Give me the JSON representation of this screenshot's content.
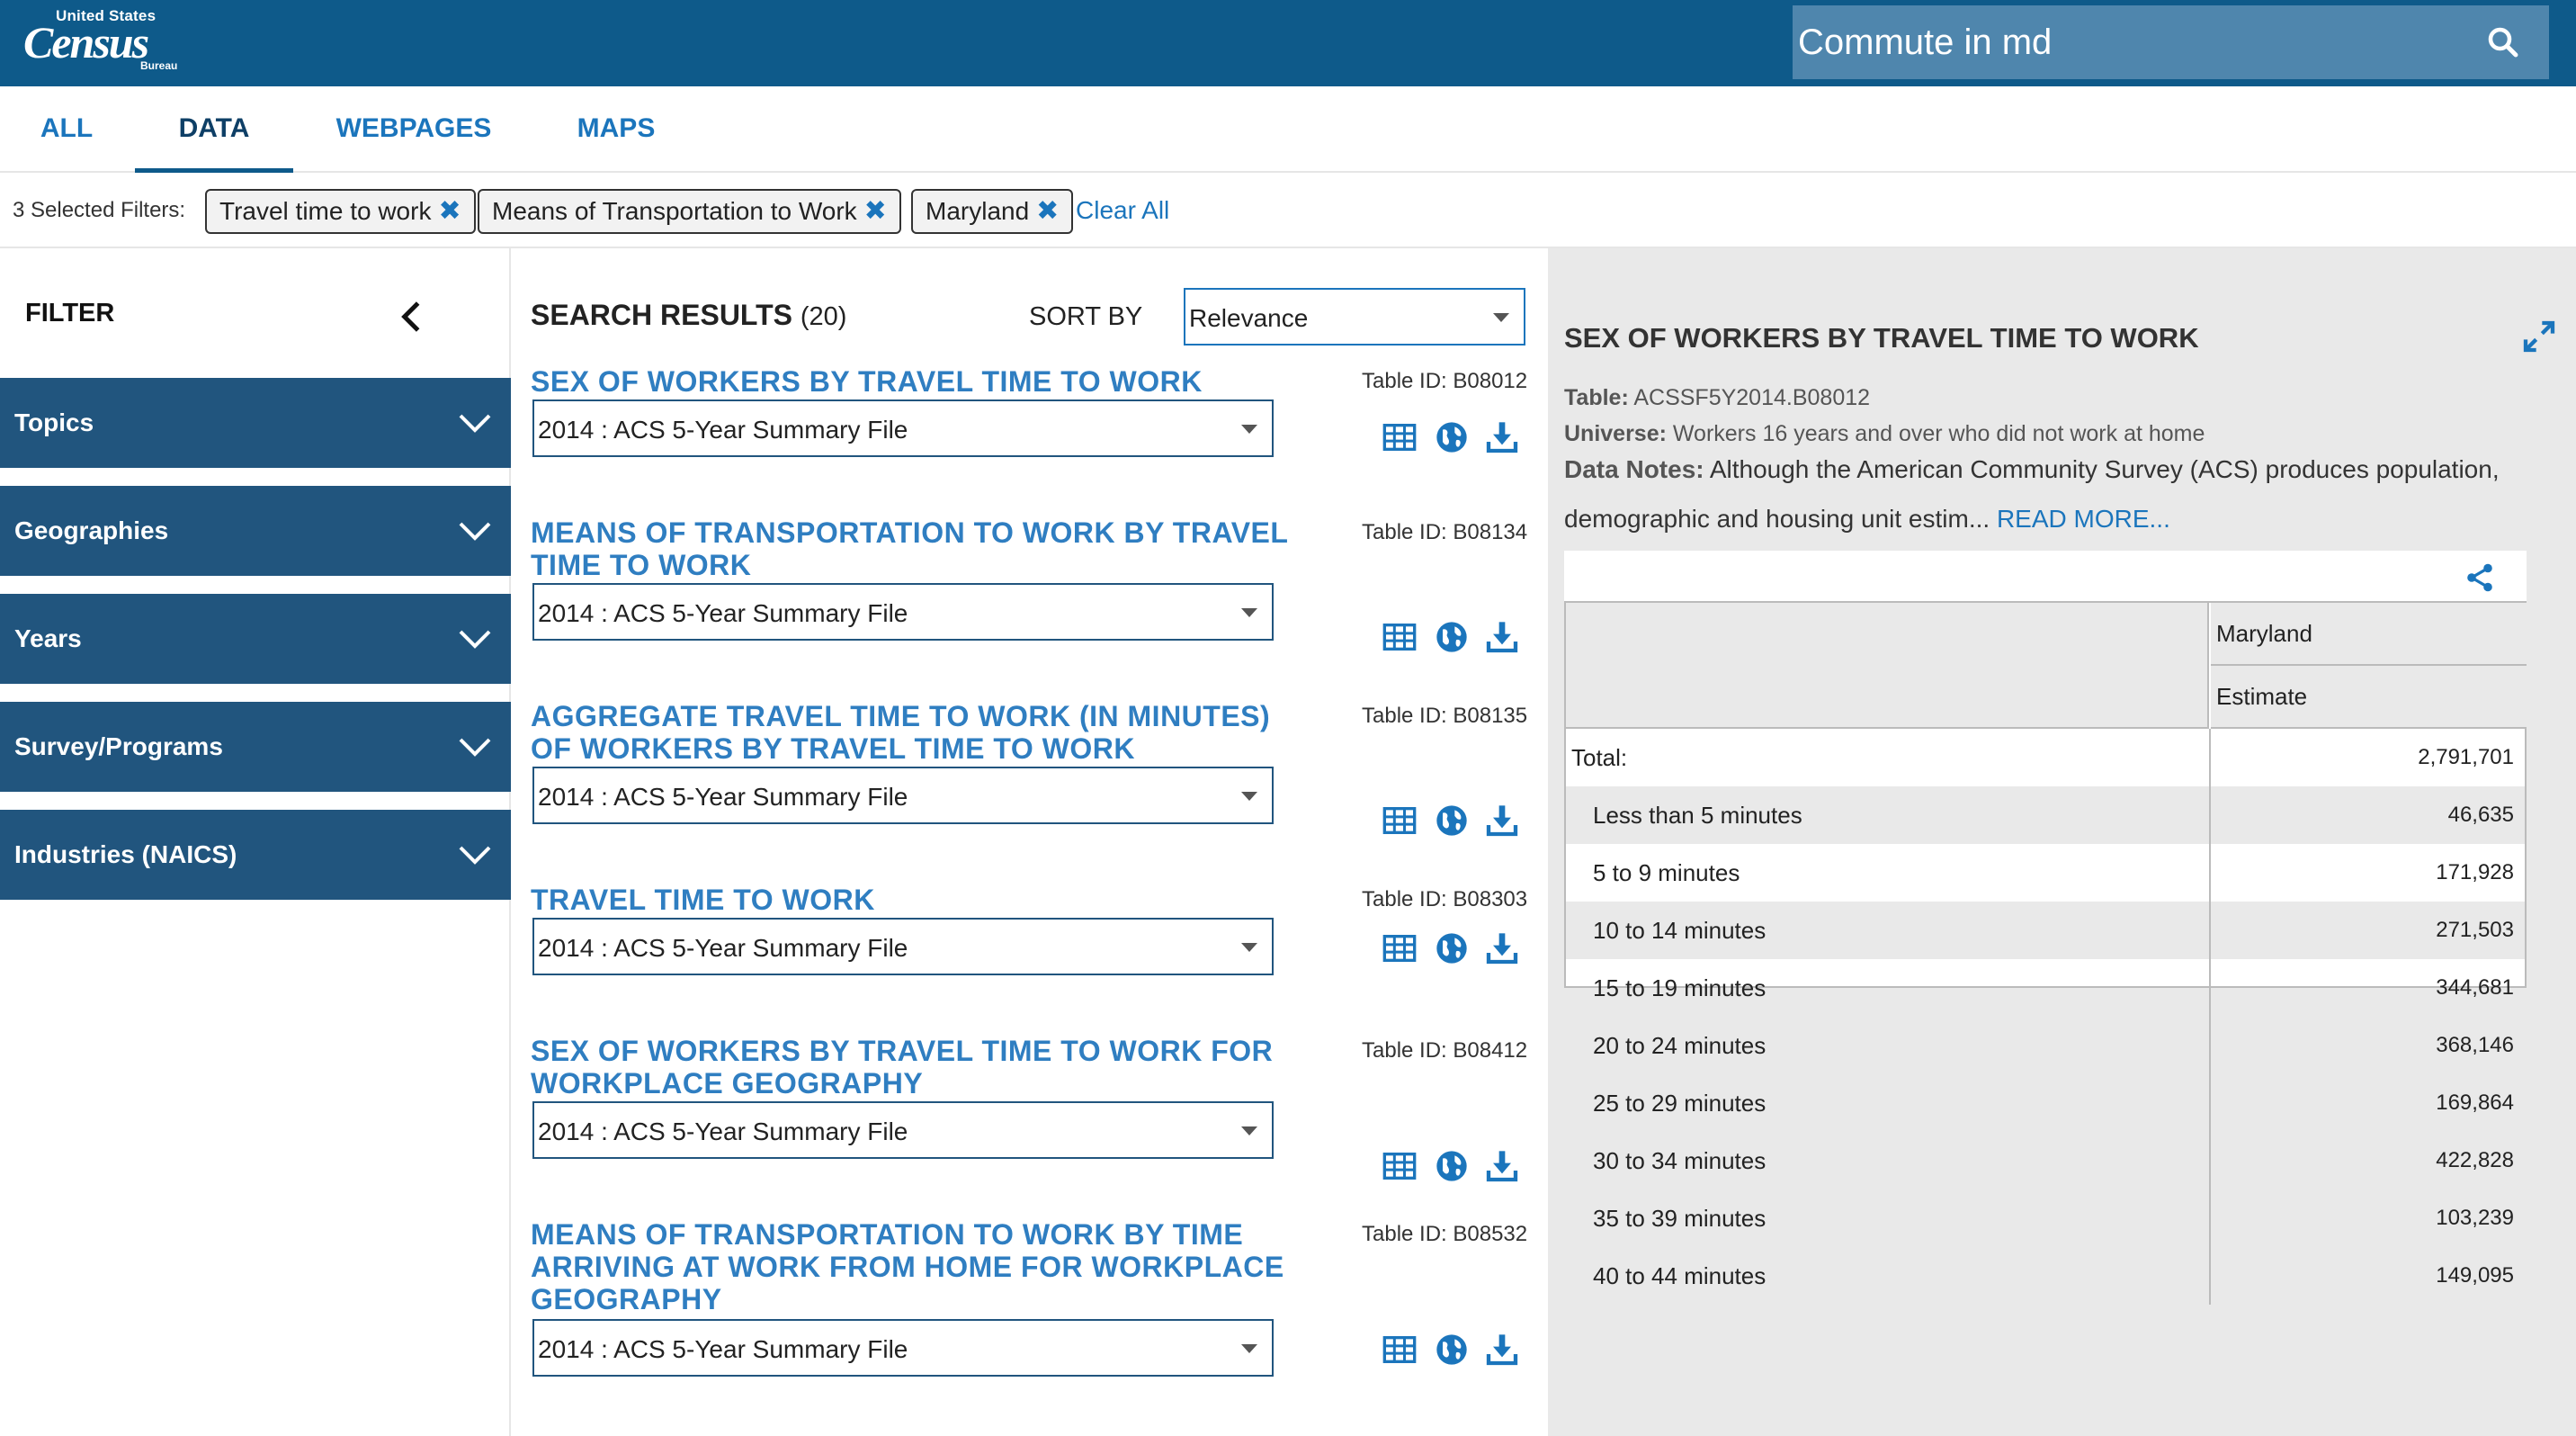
{
  "header": {
    "logo": {
      "line1": "United States",
      "line2": "Census",
      "line3": "Bureau"
    },
    "search": {
      "value": "Commute in md",
      "icon": "search-icon"
    }
  },
  "tabs": [
    {
      "label": "ALL",
      "active": false
    },
    {
      "label": "DATA",
      "active": true
    },
    {
      "label": "WEBPAGES",
      "active": false
    },
    {
      "label": "MAPS",
      "active": false
    }
  ],
  "filters": {
    "label": "3 Selected Filters:",
    "chips": [
      {
        "label": "Travel time to work"
      },
      {
        "label": "Means of Transportation to Work"
      },
      {
        "label": "Maryland"
      }
    ],
    "remove_glyph": "✖",
    "clear_all": "Clear All"
  },
  "sidebar": {
    "title": "FILTER",
    "facets": [
      {
        "label": "Topics"
      },
      {
        "label": "Geographies"
      },
      {
        "label": "Years"
      },
      {
        "label": "Survey/Programs"
      },
      {
        "label": "Industries (NAICS)"
      }
    ]
  },
  "results": {
    "title": "SEARCH RESULTS",
    "count": "(20)",
    "sort_label": "SORT BY",
    "sort_value": "Relevance",
    "items": [
      {
        "title": "SEX OF WORKERS BY TRAVEL TIME TO WORK",
        "table_id": "Table ID: B08012",
        "dataset": "2014 : ACS 5-Year Summary File"
      },
      {
        "title": "MEANS OF TRANSPORTATION TO WORK BY TRAVEL TIME TO WORK",
        "table_id": "Table ID: B08134",
        "dataset": "2014 : ACS 5-Year Summary File"
      },
      {
        "title": "AGGREGATE TRAVEL TIME TO WORK (IN MINUTES) OF WORKERS BY TRAVEL TIME TO WORK",
        "table_id": "Table ID: B08135",
        "dataset": "2014 : ACS 5-Year Summary File"
      },
      {
        "title": "TRAVEL TIME TO WORK",
        "table_id": "Table ID: B08303",
        "dataset": "2014 : ACS 5-Year Summary File"
      },
      {
        "title": "SEX OF WORKERS BY TRAVEL TIME TO WORK FOR WORKPLACE GEOGRAPHY",
        "table_id": "Table ID: B08412",
        "dataset": "2014 : ACS 5-Year Summary File"
      },
      {
        "title": "MEANS OF TRANSPORTATION TO WORK BY TIME ARRIVING AT WORK FROM HOME FOR WORKPLACE GEOGRAPHY",
        "table_id": "Table ID: B08532",
        "dataset": "2014 : ACS 5-Year Summary File"
      }
    ]
  },
  "preview": {
    "title": "SEX OF WORKERS BY TRAVEL TIME TO WORK",
    "table_label": "Table:",
    "table_value": "ACSSF5Y2014.B08012",
    "universe_label": "Universe:",
    "universe_value": "Workers 16 years and over who did not work at home",
    "notes_label": "Data Notes:",
    "notes_text": "Although the American Community Survey (ACS) produces population, demographic and housing unit estim...",
    "read_more": "READ MORE...",
    "table": {
      "col_geo": "Maryland",
      "col_measure": "Estimate",
      "rows": [
        {
          "label": "Total:",
          "value": "2,791,701",
          "indent": false
        },
        {
          "label": "Less than 5 minutes",
          "value": "46,635",
          "indent": true
        },
        {
          "label": "5 to 9 minutes",
          "value": "171,928",
          "indent": true
        },
        {
          "label": "10 to 14 minutes",
          "value": "271,503",
          "indent": true
        },
        {
          "label": "15 to 19 minutes",
          "value": "344,681",
          "indent": true
        },
        {
          "label": "20 to 24 minutes",
          "value": "368,146",
          "indent": true
        },
        {
          "label": "25 to 29 minutes",
          "value": "169,864",
          "indent": true
        },
        {
          "label": "30 to 34 minutes",
          "value": "422,828",
          "indent": true
        },
        {
          "label": "35 to 39 minutes",
          "value": "103,239",
          "indent": true
        },
        {
          "label": "40 to 44 minutes",
          "value": "149,095",
          "indent": true
        }
      ]
    }
  },
  "colors": {
    "header_bg": "#0e5a8a",
    "accent_link": "#2f7ec1",
    "facet_bg": "#21557e",
    "preview_bg": "#e9e9e9"
  }
}
